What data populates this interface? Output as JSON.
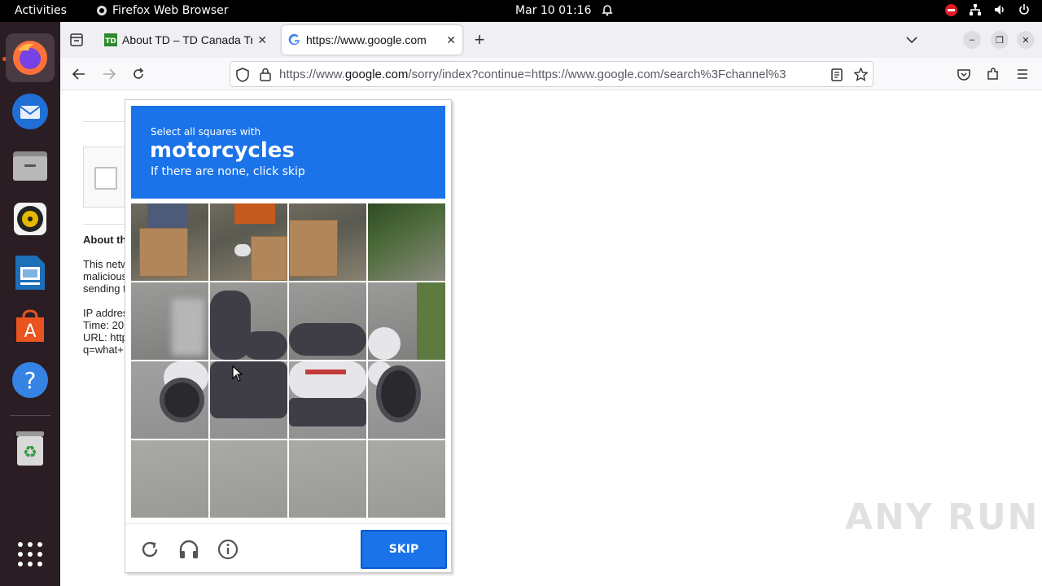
{
  "topbar": {
    "activities": "Activities",
    "app_name": "Firefox Web Browser",
    "clock": "Mar 10  01:16"
  },
  "tabs": [
    {
      "title": "About TD – TD Canada Tr",
      "favicon": "td-logo-icon",
      "active": false
    },
    {
      "title": "https://www.google.com",
      "favicon": "google-g-icon",
      "active": true
    }
  ],
  "urlbar": {
    "url_prefix": "https://www.",
    "url_domain": "google.com",
    "url_rest": "/sorry/index?continue=https://www.google.com/search%3Fchannel%3"
  },
  "background_page": {
    "heading_fragment": "About th",
    "para_lines": [
      "This netw",
      "malicious",
      "sending t"
    ],
    "info_lines": [
      "IP addres",
      "Time: 20",
      "URL: http",
      "q=what+"
    ]
  },
  "captcha": {
    "instruction_small": "Select all squares with",
    "target_object": "motorcycles",
    "instruction_sub": "If there are none, click skip",
    "grid_size": 4,
    "skip_label": "SKIP",
    "footer_icons": [
      "reload-icon",
      "audio-headphones-icon",
      "info-icon"
    ],
    "accent_color": "#1a73e8"
  },
  "watermark": "ANY RUN",
  "colors": {
    "dock_bg": "#2b1d24",
    "topbar_bg": "#000000",
    "running_indicator": "#e95420"
  }
}
